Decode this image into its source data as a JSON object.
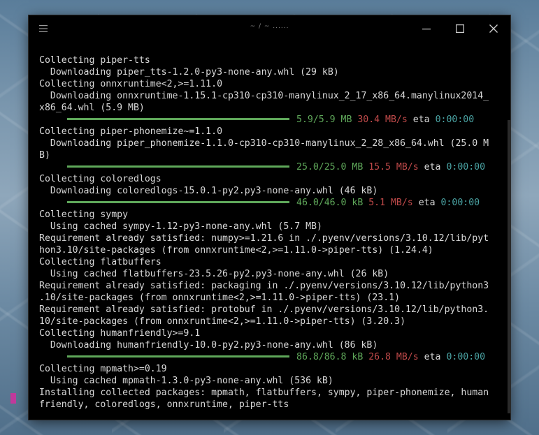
{
  "window": {
    "title": "~ / ~ ......",
    "menu_icon": "hamburger-icon",
    "minimize_icon": "minimize-icon",
    "maximize_icon": "maximize-icon",
    "close_icon": "close-icon"
  },
  "terminal": {
    "lines": [
      {
        "type": "text",
        "text": "Collecting piper-tts"
      },
      {
        "type": "text",
        "text": "  Downloading piper_tts-1.2.0-py3-none-any.whl (29 kB)"
      },
      {
        "type": "text",
        "text": "Collecting onnxruntime<2,>=1.11.0"
      },
      {
        "type": "text",
        "text": "  Downloading onnxruntime-1.15.1-cp310-cp310-manylinux_2_17_x86_64.manylinux2014_"
      },
      {
        "type": "text",
        "text": "x86_64.whl (5.9 MB)"
      },
      {
        "type": "progress",
        "progress": 1.0,
        "size": "5.9/5.9 MB",
        "speed": "30.4 MB/s",
        "eta_label": "eta",
        "eta": "0:00:00"
      },
      {
        "type": "text",
        "text": "Collecting piper-phonemize~=1.1.0"
      },
      {
        "type": "text",
        "text": "  Downloading piper_phonemize-1.1.0-cp310-cp310-manylinux_2_28_x86_64.whl (25.0 M"
      },
      {
        "type": "text",
        "text": "B)"
      },
      {
        "type": "progress",
        "progress": 1.0,
        "size": "25.0/25.0 MB",
        "speed": "15.5 MB/s",
        "eta_label": "eta",
        "eta": "0:00:00"
      },
      {
        "type": "text",
        "text": "Collecting coloredlogs"
      },
      {
        "type": "text",
        "text": "  Downloading coloredlogs-15.0.1-py2.py3-none-any.whl (46 kB)"
      },
      {
        "type": "progress",
        "progress": 1.0,
        "size": "46.0/46.0 kB",
        "speed": "5.1 MB/s",
        "eta_label": "eta",
        "eta": "0:00:00"
      },
      {
        "type": "text",
        "text": "Collecting sympy"
      },
      {
        "type": "text",
        "text": "  Using cached sympy-1.12-py3-none-any.whl (5.7 MB)"
      },
      {
        "type": "text",
        "text": "Requirement already satisfied: numpy>=1.21.6 in ./.pyenv/versions/3.10.12/lib/pyt"
      },
      {
        "type": "text",
        "text": "hon3.10/site-packages (from onnxruntime<2,>=1.11.0->piper-tts) (1.24.4)"
      },
      {
        "type": "text",
        "text": "Collecting flatbuffers"
      },
      {
        "type": "text",
        "text": "  Using cached flatbuffers-23.5.26-py2.py3-none-any.whl (26 kB)"
      },
      {
        "type": "text",
        "text": "Requirement already satisfied: packaging in ./.pyenv/versions/3.10.12/lib/python3"
      },
      {
        "type": "text",
        "text": ".10/site-packages (from onnxruntime<2,>=1.11.0->piper-tts) (23.1)"
      },
      {
        "type": "text",
        "text": "Requirement already satisfied: protobuf in ./.pyenv/versions/3.10.12/lib/python3."
      },
      {
        "type": "text",
        "text": "10/site-packages (from onnxruntime<2,>=1.11.0->piper-tts) (3.20.3)"
      },
      {
        "type": "text",
        "text": "Collecting humanfriendly>=9.1"
      },
      {
        "type": "text",
        "text": "  Downloading humanfriendly-10.0-py2.py3-none-any.whl (86 kB)"
      },
      {
        "type": "progress",
        "progress": 1.0,
        "size": "86.8/86.8 kB",
        "speed": "26.8 MB/s",
        "eta_label": "eta",
        "eta": "0:00:00"
      },
      {
        "type": "text",
        "text": "Collecting mpmath>=0.19"
      },
      {
        "type": "text",
        "text": "  Using cached mpmath-1.3.0-py3-none-any.whl (536 kB)"
      },
      {
        "type": "text",
        "text": "Installing collected packages: mpmath, flatbuffers, sympy, piper-phonemize, human"
      },
      {
        "type": "text",
        "text": "friendly, coloredlogs, onnxruntime, piper-tts"
      }
    ]
  },
  "colors": {
    "progress_green": "#5fa85a",
    "speed_red": "#c04a4a",
    "eta_cyan": "#4aa3a3",
    "cursor_magenta": "#c0399b"
  }
}
